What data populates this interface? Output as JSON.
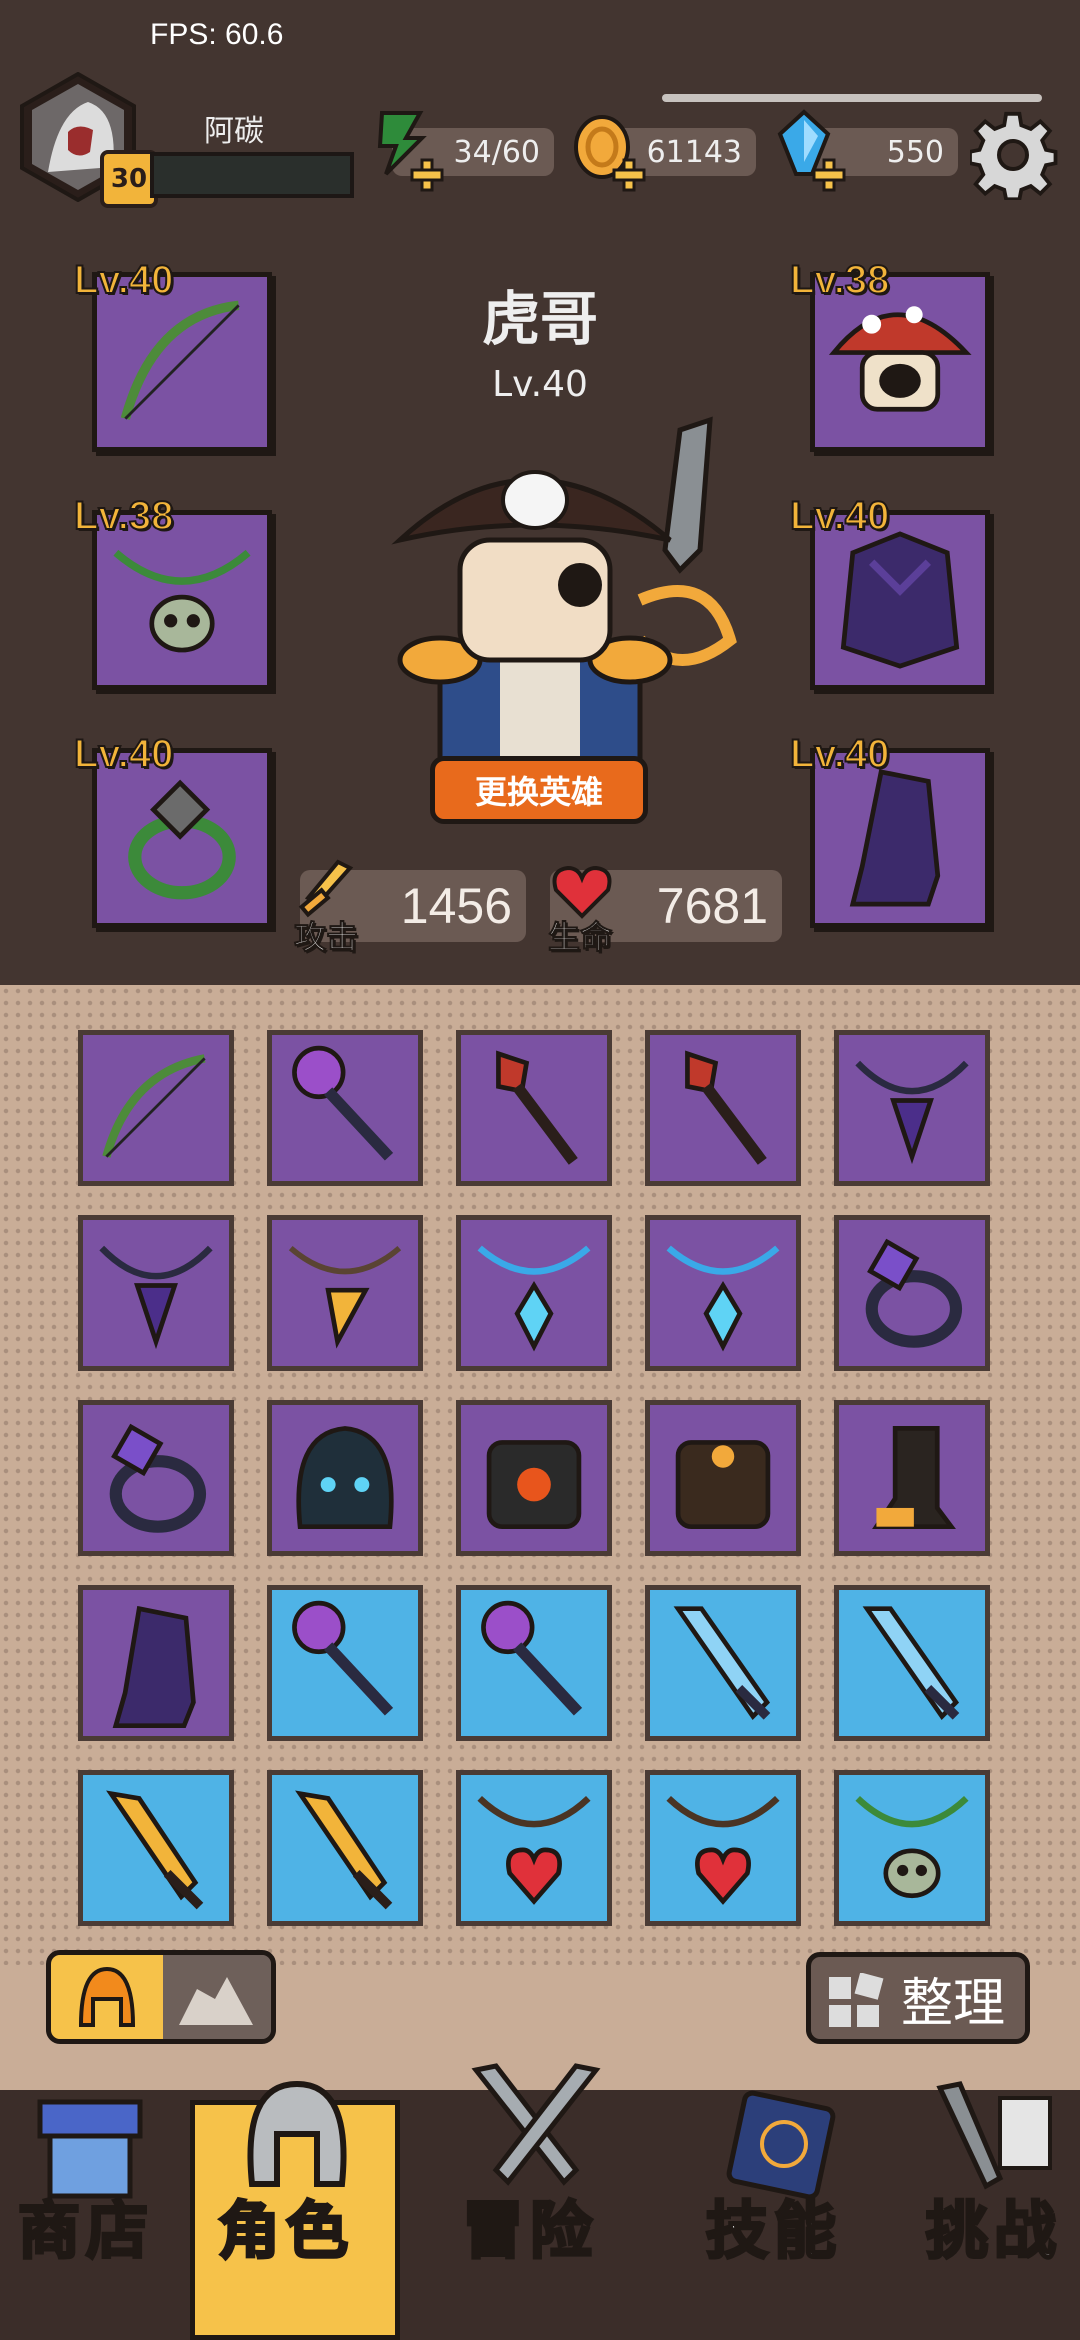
{
  "status": {
    "fps": "FPS: 60.6"
  },
  "player": {
    "name": "阿碳",
    "level": "30"
  },
  "resources": {
    "energy": "34/60",
    "gold": "61143",
    "gems": "550"
  },
  "hero": {
    "name": "虎哥",
    "level": "Lv.40",
    "change_label": "更换英雄"
  },
  "stats": {
    "attack_label": "攻击",
    "attack_value": "1456",
    "hp_label": "生命",
    "hp_value": "7681"
  },
  "equipped": [
    {
      "slot": "bow",
      "level": "Lv.40"
    },
    {
      "slot": "mushroom-helmet",
      "level": "Lv.38"
    },
    {
      "slot": "skull-necklace",
      "level": "Lv.38"
    },
    {
      "slot": "armor",
      "level": "Lv.40"
    },
    {
      "slot": "ring",
      "level": "Lv.40"
    },
    {
      "slot": "boots",
      "level": "Lv.40"
    }
  ],
  "inventory": [
    [
      "bow",
      "purple"
    ],
    [
      "staff-orb",
      "purple"
    ],
    [
      "torch",
      "purple"
    ],
    [
      "torch",
      "purple"
    ],
    [
      "dark-amulet",
      "purple"
    ],
    [
      "dark-amulet",
      "purple"
    ],
    [
      "gold-amulet",
      "purple"
    ],
    [
      "crystal-necklace",
      "purple"
    ],
    [
      "crystal-necklace",
      "purple"
    ],
    [
      "ring",
      "purple"
    ],
    [
      "ring",
      "purple"
    ],
    [
      "helmet",
      "purple"
    ],
    [
      "fire-armor",
      "purple"
    ],
    [
      "dark-armor",
      "purple"
    ],
    [
      "boot",
      "purple"
    ],
    [
      "armor-boot",
      "purple"
    ],
    [
      "staff-orb",
      "blue"
    ],
    [
      "staff-orb",
      "blue"
    ],
    [
      "sword",
      "blue"
    ],
    [
      "sword",
      "blue"
    ],
    [
      "gold-sword",
      "blue"
    ],
    [
      "gold-sword",
      "blue"
    ],
    [
      "heart-necklace",
      "blue"
    ],
    [
      "heart-necklace",
      "blue"
    ],
    [
      "skull-necklace",
      "blue"
    ]
  ],
  "controls": {
    "sort_label": "整理"
  },
  "nav": {
    "shop": "商店",
    "character": "角色",
    "adventure": "冒险",
    "skills": "技能",
    "challenge": "挑战"
  },
  "colors": {
    "background": "#433530",
    "rare": "#7b52a3",
    "common": "#4fb3e6",
    "accent": "#f6c24a",
    "button": "#e86a1c"
  }
}
